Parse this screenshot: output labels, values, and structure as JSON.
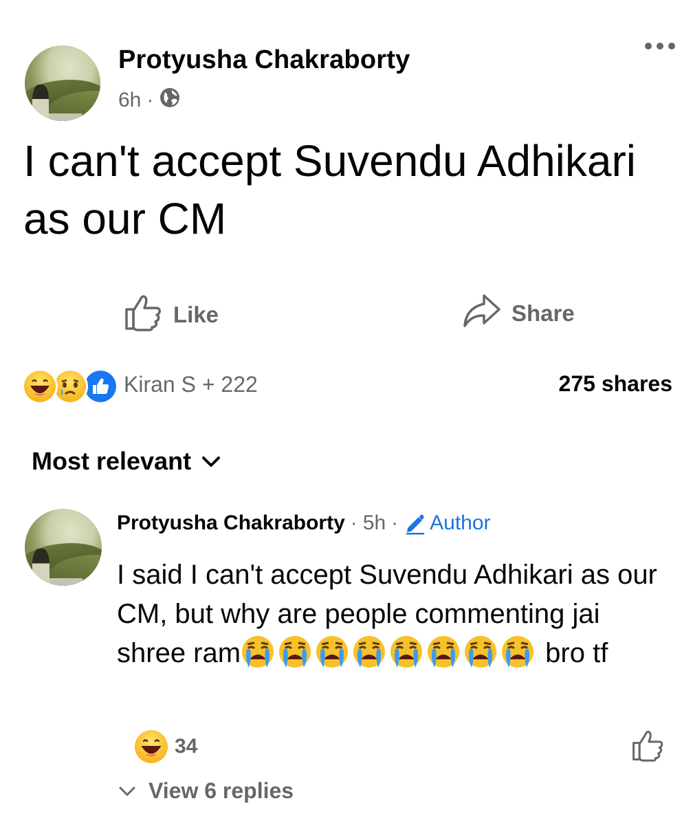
{
  "post": {
    "author": "Protyusha Chakraborty",
    "time": "6h",
    "separator": "·",
    "privacy_icon": "globe-icon",
    "text": "I can't accept Suvendu Adhikari as our CM"
  },
  "actions": {
    "like_label": "Like",
    "share_label": "Share"
  },
  "reactions_summary": {
    "icons": [
      "laugh-emoji-icon",
      "sad-emoji-icon",
      "like-reaction-icon"
    ],
    "label": "Kiran S + 222",
    "shares": "275 shares"
  },
  "comments_sort": {
    "label": "Most relevant",
    "icon": "chevron-down-icon"
  },
  "comment": {
    "author": "Protyusha Chakraborty",
    "separator": "·",
    "time": "5h",
    "badge": "Author",
    "badge_icon": "pencil-icon",
    "text_part1": "I said I can't accept Suvendu Adhikari as our CM, but why are people commenting jai shree ram",
    "emoji": "loudly-crying-face-icon",
    "emoji_count": 8,
    "text_part2": " bro tf",
    "reaction_count": "34",
    "reaction_icon": "laugh-emoji-icon",
    "view_replies": "View 6 replies"
  },
  "colors": {
    "text": "#050505",
    "secondary": "#65676b",
    "accent": "#1b74e4"
  }
}
